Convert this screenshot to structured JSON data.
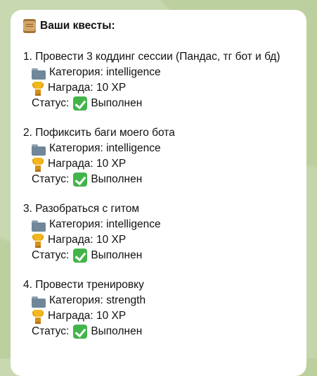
{
  "header": {
    "title": "Ваши квесты:"
  },
  "quests": [
    {
      "title": "1. Провести 3 коддинг сессии (Пандас, тг бот и бд)",
      "category": "Категория: intelligence",
      "reward": "Награда: 10 XP",
      "status_label": "Статус:",
      "status_value": "Выполнен"
    },
    {
      "title": "2. Пофиксить баги моего бота",
      "category": "Категория: intelligence",
      "reward": "Награда: 10 XP",
      "status_label": "Статус:",
      "status_value": "Выполнен"
    },
    {
      "title": "3. Разобраться с гитом",
      "category": "Категория: intelligence",
      "reward": "Награда: 10 XP",
      "status_label": "Статус:",
      "status_value": "Выполнен"
    },
    {
      "title": "4. Провести тренировку",
      "category": "Категория: strength",
      "reward": "Награда: 10 XP",
      "status_label": "Статус:",
      "status_value": "Выполнен"
    }
  ],
  "icons": {
    "header": "scroll-icon",
    "category": "folder-icon",
    "reward": "trophy-icon",
    "status": "check-icon"
  }
}
